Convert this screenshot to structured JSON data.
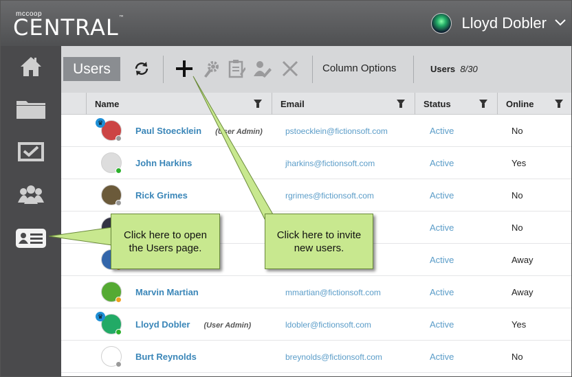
{
  "header": {
    "logo_small": "mccoop",
    "logo": "CENTRAL",
    "user_name": "Lloyd Dobler"
  },
  "sidebar": {
    "items": [
      {
        "icon": "home-icon"
      },
      {
        "icon": "folder-icon"
      },
      {
        "icon": "checkbox-icon"
      },
      {
        "icon": "groups-icon"
      },
      {
        "icon": "user-card-icon"
      }
    ]
  },
  "toolbar": {
    "users_label": "Users",
    "column_options_label": "Column Options",
    "users_count_label": "Users",
    "users_count_value": "8/30"
  },
  "table": {
    "headers": [
      "Name",
      "Email",
      "Status",
      "Online"
    ],
    "rows": [
      {
        "name": "Paul Stoecklein",
        "admin": "(User Admin)",
        "email": "pstoecklein@fictionsoft.com",
        "status": "Active",
        "online": "No",
        "dot": "#9a9a9a",
        "crown": true
      },
      {
        "name": "John Harkins",
        "admin": "",
        "email": "jharkins@fictionsoft.com",
        "status": "Active",
        "online": "Yes",
        "dot": "#2bb02b",
        "crown": false
      },
      {
        "name": "Rick Grimes",
        "admin": "",
        "email": "rgrimes@fictionsoft.com",
        "status": "Active",
        "online": "No",
        "dot": "#9a9a9a",
        "crown": false
      },
      {
        "name": "",
        "admin": "",
        "email": "",
        "status": "Active",
        "online": "No",
        "dot": "#9a9a9a",
        "crown": false
      },
      {
        "name": "",
        "admin": "",
        "email": "",
        "status": "Active",
        "online": "Away",
        "dot": "#f0a020",
        "crown": false
      },
      {
        "name": "Marvin Martian",
        "admin": "",
        "email": "mmartian@fictionsoft.com",
        "status": "Active",
        "online": "Away",
        "dot": "#f0a020",
        "crown": false
      },
      {
        "name": "Lloyd Dobler",
        "admin": "(User Admin)",
        "email": "ldobler@fictionsoft.com",
        "status": "Active",
        "online": "Yes",
        "dot": "#2bb02b",
        "crown": true
      },
      {
        "name": "Burt Reynolds",
        "admin": "",
        "email": "breynolds@fictionsoft.com",
        "status": "Active",
        "online": "No",
        "dot": "#9a9a9a",
        "crown": false
      }
    ]
  },
  "callouts": {
    "users_page": "Click here to open the Users page.",
    "invite": "Click here to invite new users."
  },
  "colors": {
    "accent_blue": "#3a86b8",
    "callout_green": "#c8e88f"
  }
}
